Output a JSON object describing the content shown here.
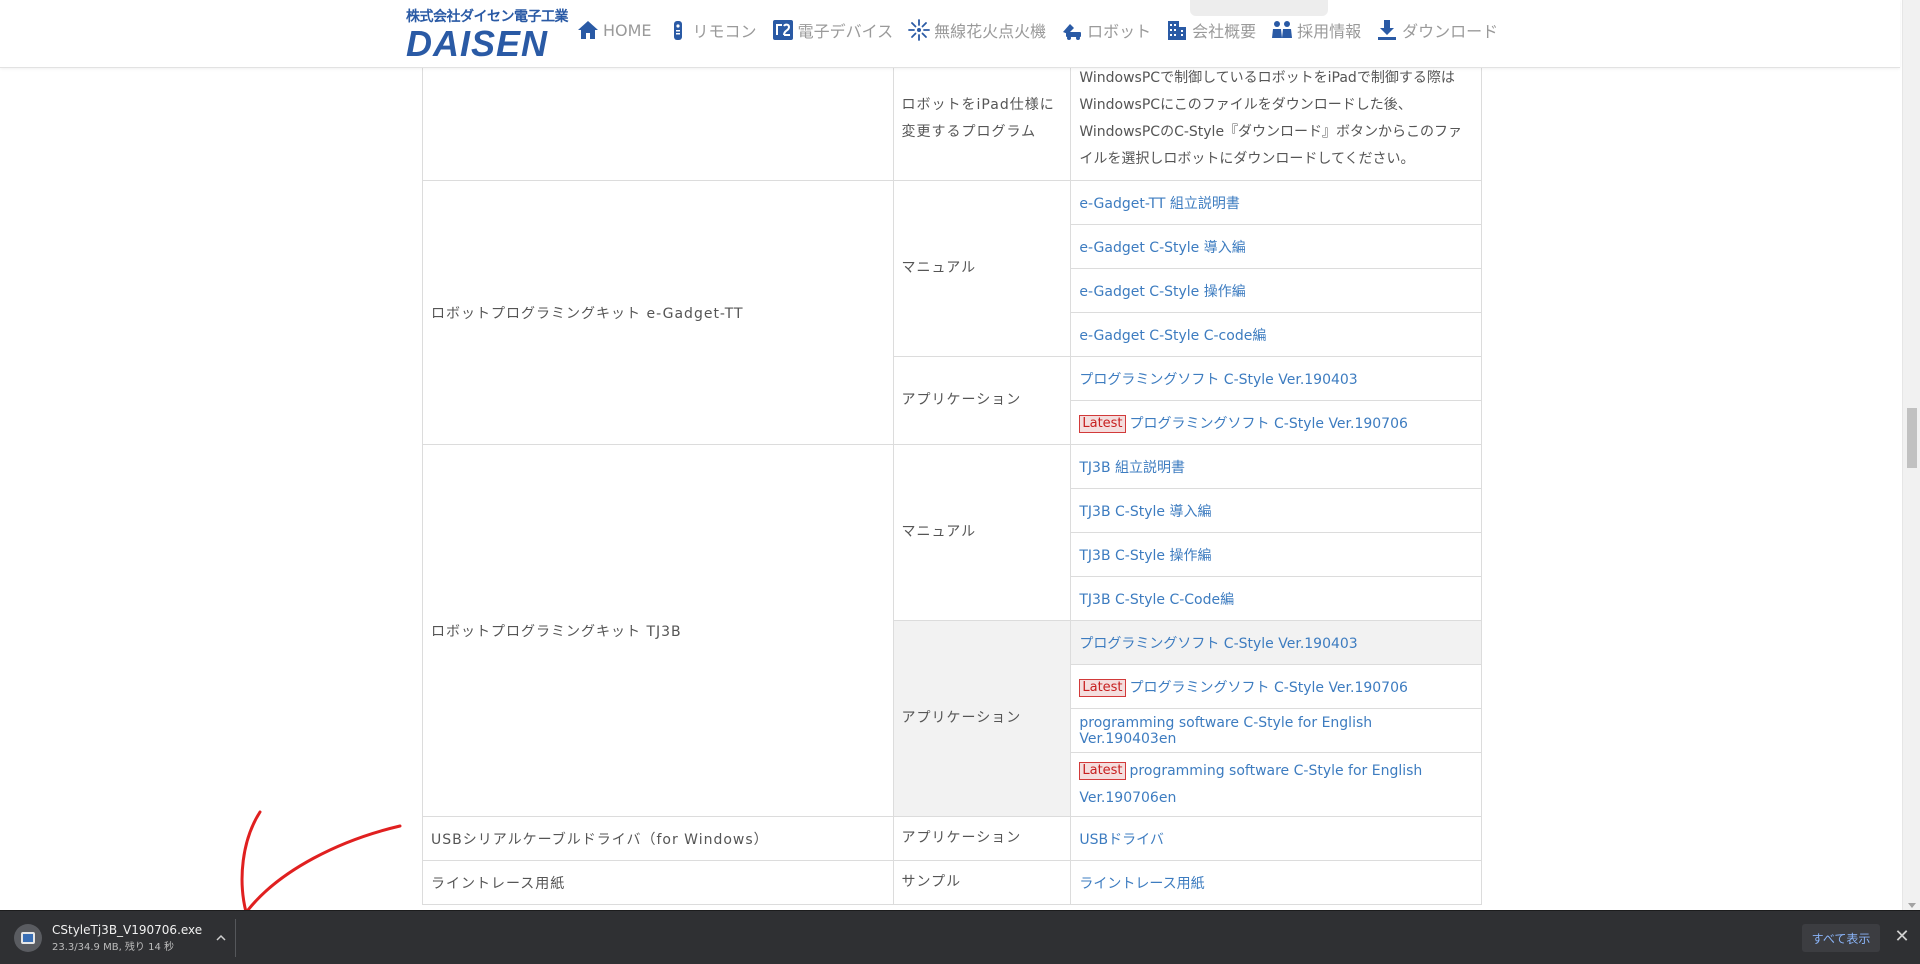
{
  "header": {
    "logo_top": "株式会社ダイセン電子工業",
    "logo_main": "DAISEN",
    "nav": [
      {
        "label": "HOME",
        "icon": "home-icon"
      },
      {
        "label": "リモコン",
        "icon": "remote-icon"
      },
      {
        "label": "電子デバイス",
        "icon": "device-icon"
      },
      {
        "label": "無線花火点火機",
        "icon": "fireworks-icon"
      },
      {
        "label": "ロボット",
        "icon": "robot-icon"
      },
      {
        "label": "会社概要",
        "icon": "building-icon"
      },
      {
        "label": "採用情報",
        "icon": "people-icon"
      },
      {
        "label": "ダウンロード",
        "icon": "download-icon"
      }
    ]
  },
  "table": {
    "ipad_row": {
      "category": "ロボットをiPad仕様に変更するプログラム",
      "description": "WindowsPCで制御しているロボットをiPadで制御する際はWindowsPCにこのファイルをダウンロードした後、WindowsPCのC-Style『ダウンロード』ボタンからこのファイルを選択しロボットにダウンロードしてください。"
    },
    "egadget": {
      "product": "ロボットプログラミングキット e-Gadget-TT",
      "manual_label": "マニュアル",
      "manuals": [
        "e-Gadget-TT 組立説明書",
        "e-Gadget C-Style 導入編",
        "e-Gadget C-Style 操作編",
        "e-Gadget C-Style C-code編"
      ],
      "app_label": "アプリケーション",
      "apps": [
        "プログラミングソフト C-Style Ver.190403",
        "プログラミングソフト C-Style Ver.190706"
      ]
    },
    "tj3b": {
      "product": "ロボットプログラミングキット TJ3B",
      "manual_label": "マニュアル",
      "manuals": [
        "TJ3B 組立説明書",
        "TJ3B C-Style 導入編",
        "TJ3B C-Style 操作編",
        "TJ3B C-Style C-Code編"
      ],
      "app_label": "アプリケーション",
      "apps": [
        "プログラミングソフト C-Style Ver.190403",
        "プログラミングソフト C-Style Ver.190706",
        "programming software C-Style for English Ver.190403en",
        "programming software C-Style for English Ver.190706en"
      ]
    },
    "usb": {
      "product": "USBシリアルケーブルドライバ（for Windows）",
      "type": "アプリケーション",
      "link": "USBドライバ"
    },
    "linetrace": {
      "product": "ライントレース用紙",
      "type": "サンプル",
      "link": "ライントレース用紙"
    },
    "latest_badge": "Latest"
  },
  "download_bar": {
    "file_name": "CStyleTj3B_V190706.exe",
    "status": "23.3/34.9 MB, 残り 14 秒",
    "show_all": "すべて表示",
    "close": "✕"
  },
  "colors": {
    "brand": "#2a5aa5",
    "link": "#3d7cc0",
    "latest": "#c71f1f",
    "annotation": "#e02020"
  }
}
